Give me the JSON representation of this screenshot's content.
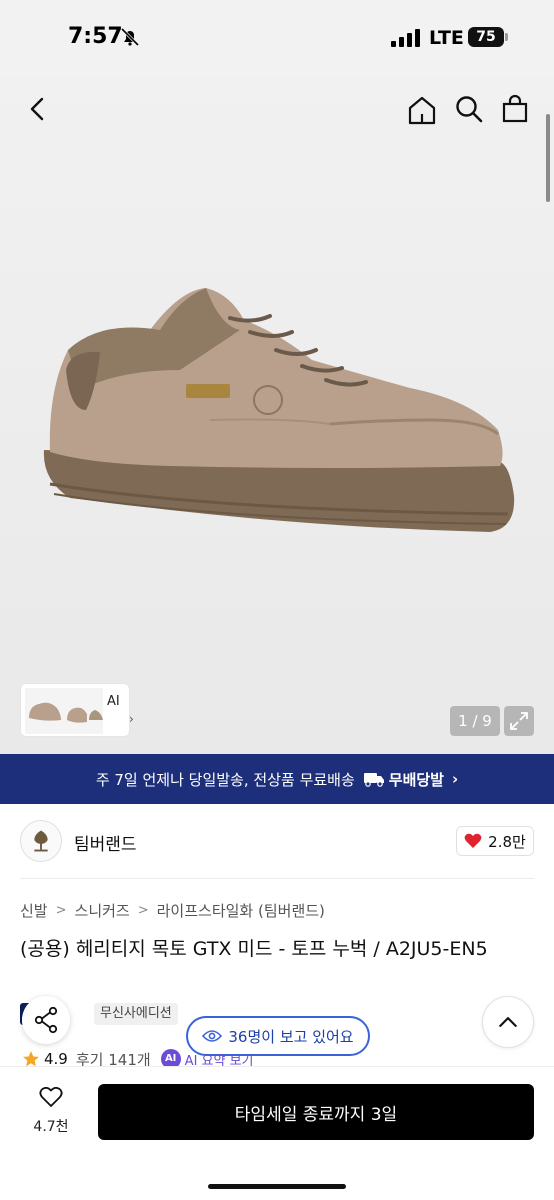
{
  "status": {
    "time": "7:57",
    "network": "LTE",
    "battery": "75"
  },
  "gallery": {
    "counter": "1 / 9",
    "thumb_label": "AI",
    "thumb_chevron": "›"
  },
  "banner": {
    "text": "주 7일 언제나 당일발송, 전상품 무료배송",
    "badge": "무배당발",
    "chevron": "›"
  },
  "brand": {
    "name": "팀버랜드",
    "likes": "2.8만"
  },
  "breadcrumb": [
    "신발",
    "스니커즈",
    "라이프스타일화 (팀버랜드)"
  ],
  "product": {
    "title": "(공용) 헤리티지 목토 GTX 미드 - 토프 누벅 / A2JU5-EN5"
  },
  "tags": {
    "pay": "페이",
    "edition": "무신사에디션"
  },
  "viewers": "36명이 보고 있어요",
  "rating": {
    "value": "4.9",
    "reviews": "후기 141개",
    "ai_badge": "AI",
    "ai_label": "AI 요약 보기"
  },
  "bottom": {
    "wish_count": "4.7천",
    "buy_label": "타임세일 종료까지 3일"
  },
  "colors": {
    "banner_bg": "#1d2f7a",
    "accent_blue": "#3a63d8",
    "heart_red": "#e0242f",
    "star": "#f5a623"
  },
  "icons": [
    "back-icon",
    "home-icon",
    "search-icon",
    "cart-icon",
    "expand-icon",
    "share-icon",
    "eye-icon",
    "chevron-up-icon",
    "heart-icon",
    "star-icon",
    "truck-icon"
  ]
}
